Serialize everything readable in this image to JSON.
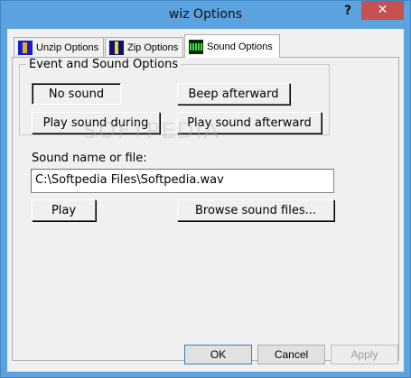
{
  "window": {
    "title": "wiz Options",
    "help_label": "?",
    "close_label": "✕"
  },
  "tabs": [
    {
      "label": "Unzip Options",
      "icon": "unzip-icon"
    },
    {
      "label": "Zip Options",
      "icon": "zip-icon"
    },
    {
      "label": "Sound Options",
      "icon": "sound-icon",
      "active": true
    }
  ],
  "event_group": {
    "title": "Event and Sound Options",
    "buttons": {
      "no_sound": "No sound",
      "beep_afterward": "Beep afterward",
      "play_during": "Play sound during",
      "play_afterward": "Play sound afterward"
    }
  },
  "sound_file": {
    "label": "Sound name or file:",
    "value": "C:\\Softpedia Files\\Softpedia.wav"
  },
  "actions": {
    "play": "Play",
    "browse": "Browse sound files..."
  },
  "footer": {
    "ok": "OK",
    "cancel": "Cancel",
    "apply": "Apply"
  },
  "watermark": "SOFTPEDIA"
}
